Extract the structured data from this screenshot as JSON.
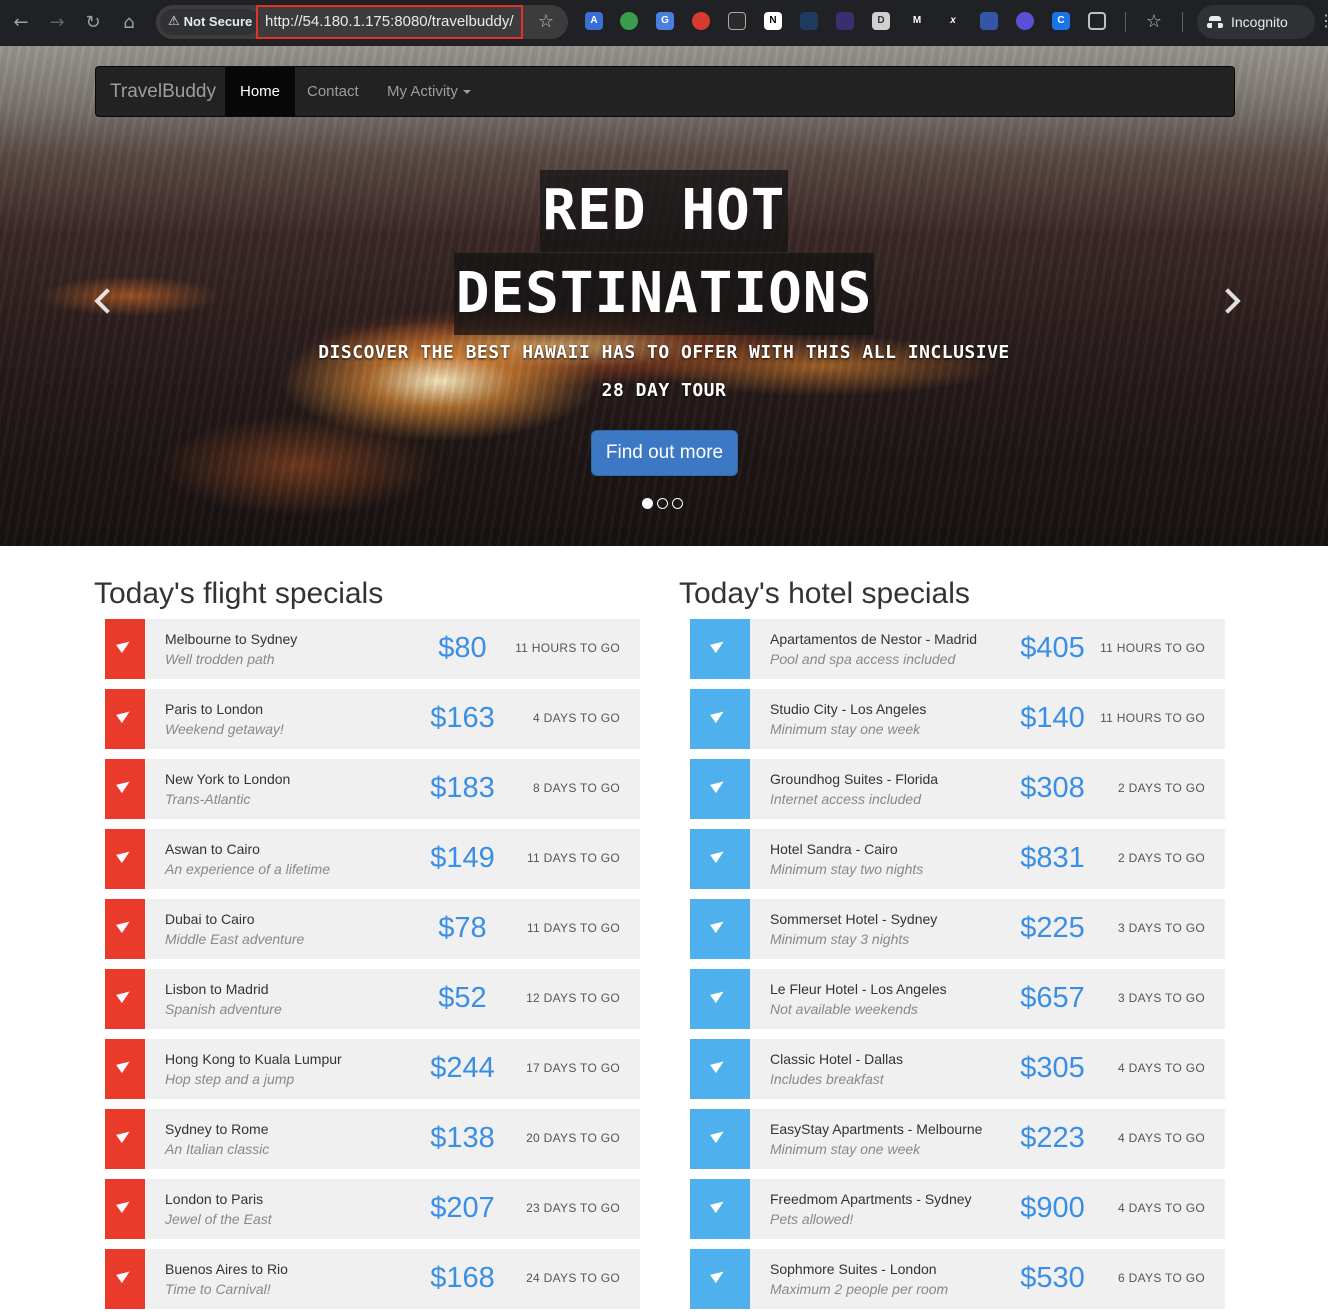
{
  "browser": {
    "security_label": "Not Secure",
    "url": "http://54.180.1.175:8080/travelbuddy/",
    "profile_label": "Incognito"
  },
  "navbar": {
    "brand": "TravelBuddy",
    "items": [
      "Home",
      "Contact",
      "My Activity"
    ]
  },
  "hero": {
    "title_line1": "RED HOT",
    "title_line2": "DESTINATIONS",
    "subtitle_line1": "DISCOVER THE BEST HAWAII HAS TO OFFER WITH THIS ALL INCLUSIVE",
    "subtitle_line2": "28 DAY TOUR",
    "cta": "Find out more",
    "slide_count": 3,
    "active_slide": 1
  },
  "flights": {
    "heading": "Today's flight specials",
    "accent_color": "#ea3a2b",
    "items": [
      {
        "name": "Melbourne to Sydney",
        "tagline": "Well trodden path",
        "price": "$80",
        "time": "11 HOURS TO GO"
      },
      {
        "name": "Paris to London",
        "tagline": "Weekend getaway!",
        "price": "$163",
        "time": "4 DAYS TO GO"
      },
      {
        "name": "New York to London",
        "tagline": "Trans-Atlantic",
        "price": "$183",
        "time": "8 DAYS TO GO"
      },
      {
        "name": "Aswan to Cairo",
        "tagline": "An experience of a lifetime",
        "price": "$149",
        "time": "11 DAYS TO GO"
      },
      {
        "name": "Dubai to Cairo",
        "tagline": "Middle East adventure",
        "price": "$78",
        "time": "11 DAYS TO GO"
      },
      {
        "name": "Lisbon to Madrid",
        "tagline": "Spanish adventure",
        "price": "$52",
        "time": "12 DAYS TO GO"
      },
      {
        "name": "Hong Kong to Kuala Lumpur",
        "tagline": "Hop step and a jump",
        "price": "$244",
        "time": "17 DAYS TO GO"
      },
      {
        "name": "Sydney to Rome",
        "tagline": "An Italian classic",
        "price": "$138",
        "time": "20 DAYS TO GO"
      },
      {
        "name": "London to Paris",
        "tagline": "Jewel of the East",
        "price": "$207",
        "time": "23 DAYS TO GO"
      },
      {
        "name": "Buenos Aires to Rio",
        "tagline": "Time to Carnival!",
        "price": "$168",
        "time": "24 DAYS TO GO"
      }
    ]
  },
  "hotels": {
    "heading": "Today's hotel specials",
    "accent_color": "#4eb0ec",
    "items": [
      {
        "name": "Apartamentos de Nestor - Madrid",
        "tagline": "Pool and spa access included",
        "price": "$405",
        "time": "11 HOURS TO GO"
      },
      {
        "name": "Studio City - Los Angeles",
        "tagline": "Minimum stay one week",
        "price": "$140",
        "time": "11 HOURS TO GO"
      },
      {
        "name": "Groundhog Suites - Florida",
        "tagline": "Internet access included",
        "price": "$308",
        "time": "2 DAYS TO GO"
      },
      {
        "name": "Hotel Sandra - Cairo",
        "tagline": "Minimum stay two nights",
        "price": "$831",
        "time": "2 DAYS TO GO"
      },
      {
        "name": "Sommerset Hotel - Sydney",
        "tagline": "Minimum stay 3 nights",
        "price": "$225",
        "time": "3 DAYS TO GO"
      },
      {
        "name": "Le Fleur Hotel - Los Angeles",
        "tagline": "Not available weekends",
        "price": "$657",
        "time": "3 DAYS TO GO"
      },
      {
        "name": "Classic Hotel - Dallas",
        "tagline": "Includes breakfast",
        "price": "$305",
        "time": "4 DAYS TO GO"
      },
      {
        "name": "EasyStay Apartments - Melbourne",
        "tagline": "Minimum stay one week",
        "price": "$223",
        "time": "4 DAYS TO GO"
      },
      {
        "name": "Freedmom Apartments - Sydney",
        "tagline": "Pets allowed!",
        "price": "$900",
        "time": "4 DAYS TO GO"
      },
      {
        "name": "Sophmore Suites - London",
        "tagline": "Maximum 2 people per room",
        "price": "$530",
        "time": "6 DAYS TO GO"
      }
    ]
  }
}
